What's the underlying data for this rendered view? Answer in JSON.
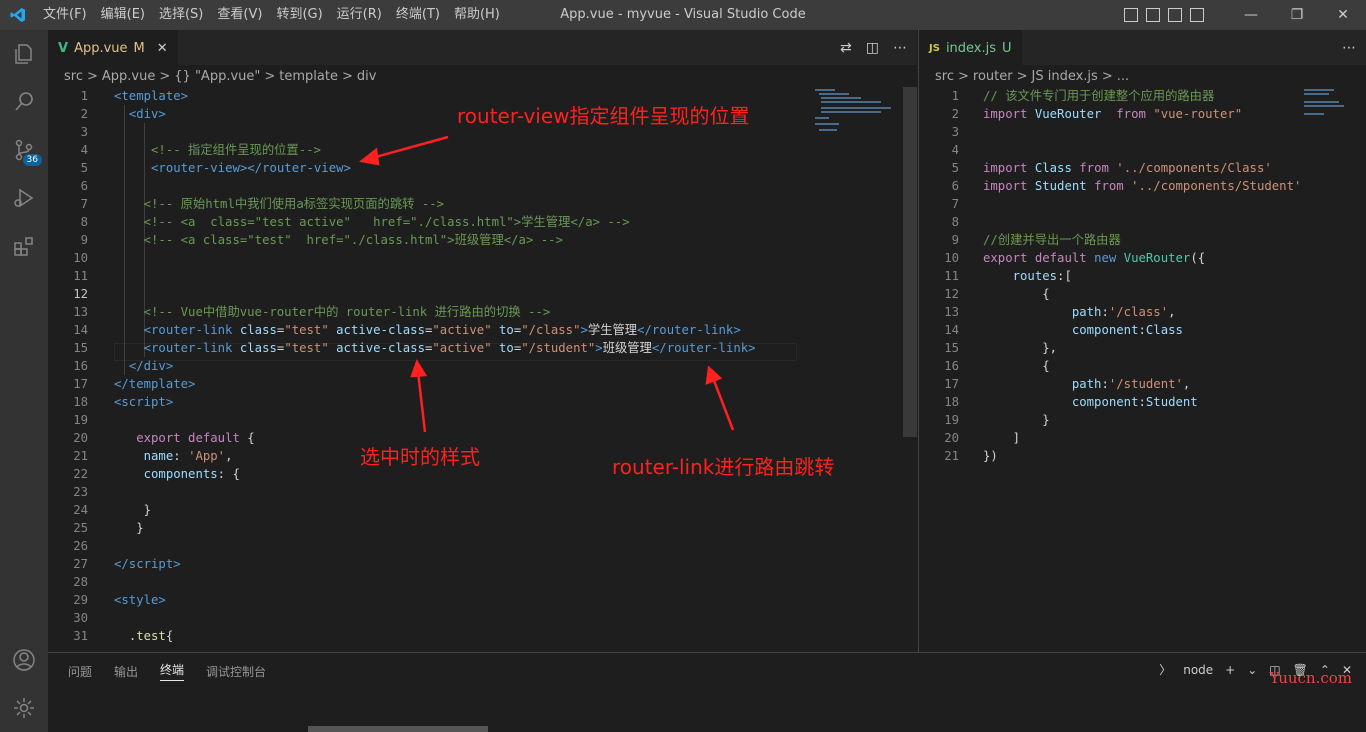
{
  "titlebar": {
    "menu": [
      "文件(F)",
      "编辑(E)",
      "选择(S)",
      "查看(V)",
      "转到(G)",
      "运行(R)",
      "终端(T)",
      "帮助(H)"
    ],
    "title": "App.vue - myvue - Visual Studio Code",
    "scm_badge": "36"
  },
  "editor1": {
    "tab": "App.vue",
    "tab_mod": "M",
    "breadcrumb": [
      "src",
      ">",
      "App.vue",
      ">",
      "{} \"App.vue\"",
      ">",
      "template",
      ">",
      "div"
    ]
  },
  "editor2": {
    "tab": "index.js",
    "tab_mod": "U",
    "breadcrumb": [
      "src",
      ">",
      "router",
      ">",
      "JS index.js",
      ">",
      "..."
    ]
  },
  "annotations": [
    "router-view指定组件呈现的位置",
    "选中时的样式",
    "router-link进行路由跳转"
  ],
  "panel": {
    "tabs": [
      "问题",
      "输出",
      "终端",
      "调试控制台"
    ],
    "shell": "node",
    "watermark": "Yuucn.com"
  },
  "colors": {
    "tag": "#569cd6",
    "attr": "#9cdcfe",
    "string": "#ce9178",
    "comment": "#6a9955",
    "keyword": "#c586c0",
    "annotation": "#ff2020"
  }
}
